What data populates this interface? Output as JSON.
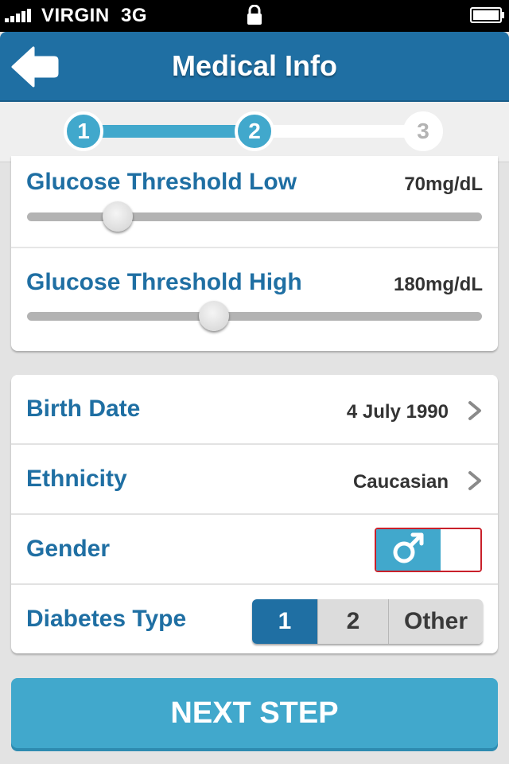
{
  "status_bar": {
    "carrier": "VIRGIN",
    "network": "3G"
  },
  "header": {
    "title": "Medical Info"
  },
  "stepper": {
    "steps": [
      "1",
      "2",
      "3"
    ],
    "current_step": 2
  },
  "thresholds": [
    {
      "label": "Glucose Threshold Low",
      "value": "70mg/dL",
      "level": 0.2
    },
    {
      "label": "Glucose Threshold High",
      "value": "180mg/dL",
      "level": 0.41
    }
  ],
  "form": {
    "birth_date": {
      "label": "Birth Date",
      "value": "4 July 1990"
    },
    "ethnicity": {
      "label": "Ethnicity",
      "value": "Caucasian"
    },
    "gender": {
      "label": "Gender",
      "selected": "male"
    },
    "diabetes_type": {
      "label": "Diabetes Type",
      "options": [
        "1",
        "2",
        "Other"
      ],
      "selected": "1"
    }
  },
  "next_button": {
    "label": "NEXT STEP"
  },
  "colors": {
    "primary": "#1f6fa3",
    "accent": "#41a8cc",
    "background": "#e3e3e3"
  },
  "icons": {
    "back": "back-arrow-icon",
    "chevron": "chevron-right-icon",
    "gender": "male-symbol-icon",
    "lock": "lock-icon",
    "battery": "battery-icon"
  }
}
